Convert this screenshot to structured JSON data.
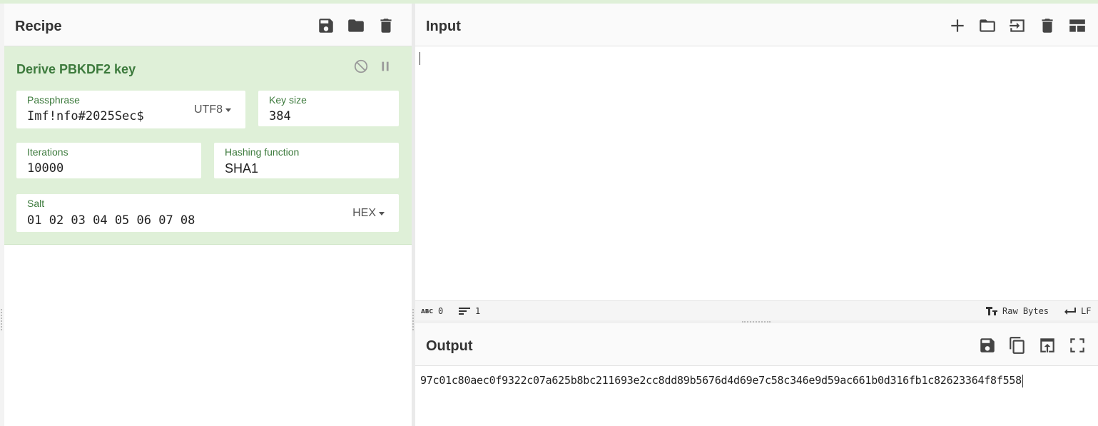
{
  "recipe": {
    "title": "Recipe",
    "icons": [
      "save-icon",
      "folder-icon",
      "trash-icon"
    ],
    "operation": {
      "name": "Derive PBKDF2 key",
      "passphrase": {
        "label": "Passphrase",
        "value": "Imf!nfo#2025Sec$",
        "encoding": "UTF8"
      },
      "key_size": {
        "label": "Key size",
        "value": "384"
      },
      "iterations": {
        "label": "Iterations",
        "value": "10000"
      },
      "hashing_function": {
        "label": "Hashing function",
        "value": "SHA1"
      },
      "salt": {
        "label": "Salt",
        "value": "01 02 03 04 05 06 07 08",
        "encoding": "HEX"
      }
    }
  },
  "input": {
    "title": "Input",
    "icons": [
      "plus-icon",
      "folder-icon",
      "import-icon",
      "trash-icon",
      "layout-icon"
    ],
    "status": {
      "chars": "0",
      "lines": "1",
      "encoding": "Raw Bytes",
      "eol": "LF"
    }
  },
  "output": {
    "title": "Output",
    "icons": [
      "save-icon",
      "copy-icon",
      "replace-input-icon",
      "fullscreen-icon"
    ],
    "value": "97c01c80aec0f9322c07a625b8bc211693e2cc8dd89b5676d4d69e7c58c346e9d59ac661b0d316fb1c82623364f8f558"
  }
}
